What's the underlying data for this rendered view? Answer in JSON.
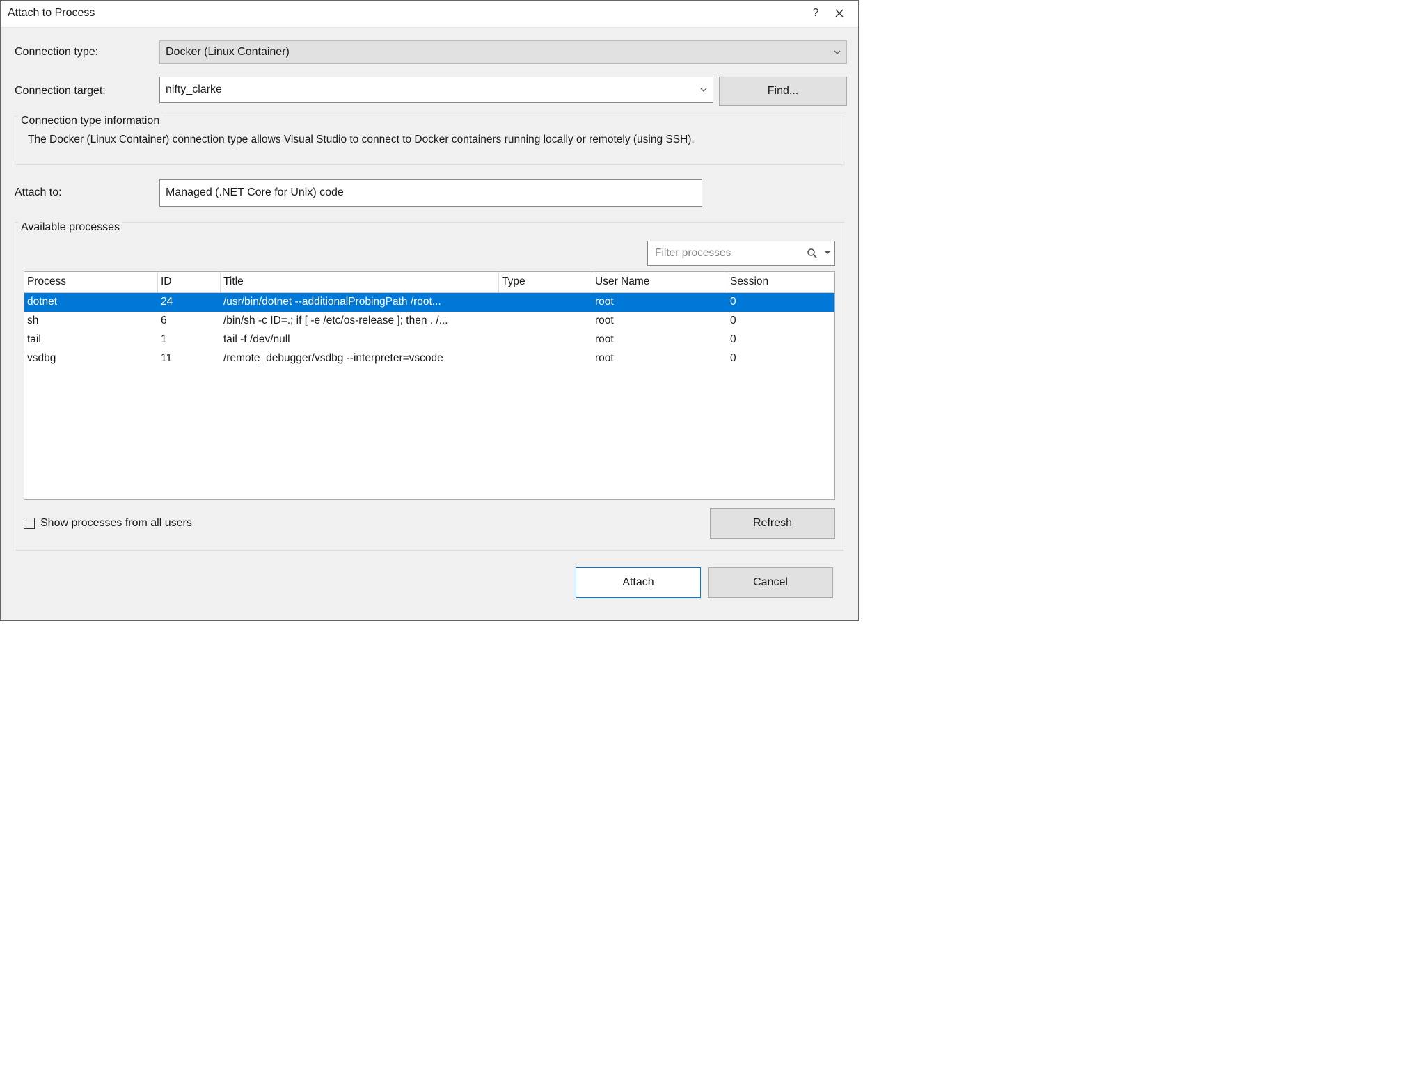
{
  "dialog": {
    "title": "Attach to Process"
  },
  "form": {
    "connection_type_label": "Connection type:",
    "connection_type_value": "Docker (Linux Container)",
    "connection_target_label": "Connection target:",
    "connection_target_value": "nifty_clarke",
    "find_button": "Find...",
    "info_title": "Connection type information",
    "info_text": "The Docker (Linux Container) connection type allows Visual Studio to connect to Docker containers running locally or remotely (using SSH).",
    "attach_to_label": "Attach to:",
    "attach_to_value": "Managed (.NET Core for Unix) code"
  },
  "processes": {
    "section_title": "Available processes",
    "filter_placeholder": "Filter processes",
    "columns": {
      "process": "Process",
      "id": "ID",
      "title": "Title",
      "type": "Type",
      "user": "User Name",
      "session": "Session"
    },
    "rows": [
      {
        "process": "dotnet",
        "id": "24",
        "title": "/usr/bin/dotnet --additionalProbingPath /root...",
        "type": "",
        "user": "root",
        "session": "0",
        "selected": true
      },
      {
        "process": "sh",
        "id": "6",
        "title": "/bin/sh -c ID=.; if [ -e /etc/os-release ]; then . /...",
        "type": "",
        "user": "root",
        "session": "0",
        "selected": false
      },
      {
        "process": "tail",
        "id": "1",
        "title": "tail -f /dev/null",
        "type": "",
        "user": "root",
        "session": "0",
        "selected": false
      },
      {
        "process": "vsdbg",
        "id": "11",
        "title": "/remote_debugger/vsdbg --interpreter=vscode",
        "type": "",
        "user": "root",
        "session": "0",
        "selected": false
      }
    ],
    "show_all_label": "Show processes from all users",
    "refresh_button": "Refresh"
  },
  "footer": {
    "attach": "Attach",
    "cancel": "Cancel"
  }
}
